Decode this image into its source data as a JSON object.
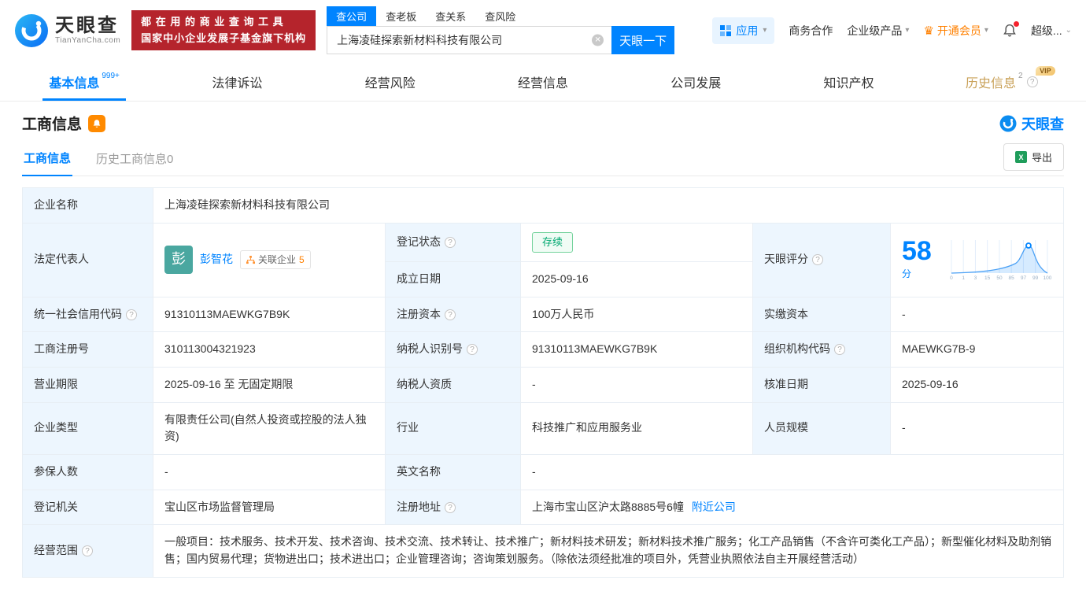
{
  "colors": {
    "accent": "#0084ff",
    "vip_orange": "#ff8000",
    "status_green": "#00a870",
    "promo_red": "#b5242c",
    "label_bg": "#edf6fe"
  },
  "header": {
    "brand": {
      "name": "天眼查",
      "domain": "TianYanCha.com"
    },
    "promo": {
      "line1": "都 在 用 的 商 业 查 询 工 具",
      "line2": "国家中小企业发展子基金旗下机构"
    },
    "search": {
      "tabs": [
        {
          "label": "查公司"
        },
        {
          "label": "查老板"
        },
        {
          "label": "查关系"
        },
        {
          "label": "查风险"
        }
      ],
      "value": "上海凌硅探索新材料科技有限公司",
      "button": "天眼一下"
    },
    "nav": {
      "apps": "应用",
      "cooperation": "商务合作",
      "enterprise": "企业级产品",
      "vip": "开通会员",
      "super": "超级..."
    }
  },
  "tabs": {
    "basic": {
      "label": "基本信息",
      "badge": "999+"
    },
    "legal": {
      "label": "法律诉讼"
    },
    "risk": {
      "label": "经营风险"
    },
    "operation": {
      "label": "经营信息"
    },
    "development": {
      "label": "公司发展"
    },
    "ip": {
      "label": "知识产权"
    },
    "history": {
      "label": "历史信息",
      "badge": "2",
      "vip": "VIP"
    }
  },
  "section": {
    "title": "工商信息",
    "brand": "天眼查",
    "subtab_active": "工商信息",
    "subtab_history": "历史工商信息0",
    "export": "导出"
  },
  "table": {
    "company_name": {
      "label": "企业名称",
      "value": "上海凌硅探索新材料科技有限公司"
    },
    "legal_rep": {
      "label": "法定代表人",
      "avatar": "彭",
      "name": "彭智花",
      "related_label": "关联企业",
      "related_count": "5"
    },
    "reg_status": {
      "label": "登记状态",
      "value": "存续"
    },
    "establish_date": {
      "label": "成立日期",
      "value": "2025-09-16"
    },
    "score": {
      "label": "天眼评分",
      "value": "58",
      "unit": "分"
    },
    "credit_code": {
      "label": "统一社会信用代码",
      "value": "91310113MAEWKG7B9K"
    },
    "reg_capital": {
      "label": "注册资本",
      "value": "100万人民币"
    },
    "paid_capital": {
      "label": "实缴资本",
      "value": "-"
    },
    "reg_number": {
      "label": "工商注册号",
      "value": "310113004321923"
    },
    "taxpayer_id": {
      "label": "纳税人识别号",
      "value": "91310113MAEWKG7B9K"
    },
    "org_code": {
      "label": "组织机构代码",
      "value": "MAEWKG7B-9"
    },
    "business_term": {
      "label": "营业期限",
      "value": "2025-09-16 至 无固定期限"
    },
    "taxpayer_qualification": {
      "label": "纳税人资质",
      "value": "-"
    },
    "approval_date": {
      "label": "核准日期",
      "value": "2025-09-16"
    },
    "company_type": {
      "label": "企业类型",
      "value": "有限责任公司(自然人投资或控股的法人独资)"
    },
    "industry": {
      "label": "行业",
      "value": "科技推广和应用服务业"
    },
    "staff_size": {
      "label": "人员规模",
      "value": "-"
    },
    "insured_count": {
      "label": "参保人数",
      "value": "-"
    },
    "english_name": {
      "label": "英文名称",
      "value": "-"
    },
    "reg_authority": {
      "label": "登记机关",
      "value": "宝山区市场监督管理局"
    },
    "reg_address": {
      "label": "注册地址",
      "value": "上海市宝山区沪太路8885号6幢",
      "nearby": "附近公司"
    },
    "business_scope": {
      "label": "经营范围",
      "value": "一般项目：技术服务、技术开发、技术咨询、技术交流、技术转让、技术推广；新材料技术研发；新材料技术推广服务；化工产品销售（不含许可类化工产品）；新型催化材料及助剂销售；国内贸易代理；货物进出口；技术进出口；企业管理咨询；咨询策划服务。（除依法须经批准的项目外，凭营业执照依法自主开展经营活动）"
    }
  },
  "score_chart": {
    "type": "area",
    "score": 58,
    "unit": "分",
    "x_ticks": [
      "0",
      "1",
      "3",
      "15",
      "50",
      "85",
      "97",
      "99",
      "100"
    ],
    "accent": "#0084ff"
  }
}
